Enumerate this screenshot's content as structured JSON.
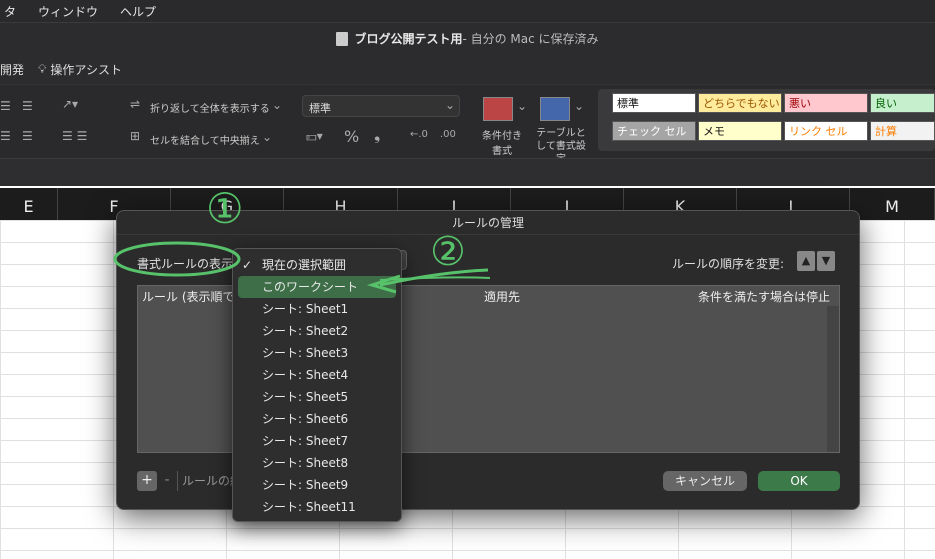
{
  "menubar": {
    "items": [
      "タ",
      "ウィンドウ",
      "ヘルプ"
    ]
  },
  "titlebar": {
    "doc_name": "ブログ公開テスト用",
    "suffix": " - 自分の Mac に保存済み"
  },
  "tabs": {
    "items": [
      "開発",
      "操作アシスト"
    ]
  },
  "ribbon": {
    "wrap_text": "折り返して全体を表示する",
    "merge_center": "セルを結合して中央揃え",
    "number_format": "標準",
    "percent": "%",
    "comma": "❟",
    "conditional_format": "条件付き\n書式",
    "table_format": "テーブルとして書式設定",
    "styles": [
      {
        "label": "標準",
        "bg": "#ffffff",
        "fg": "#111111"
      },
      {
        "label": "どちらでもない",
        "bg": "#ffeb9c",
        "fg": "#9c5700"
      },
      {
        "label": "悪い",
        "bg": "#ffc7ce",
        "fg": "#9c0006"
      },
      {
        "label": "良い",
        "bg": "#c6efce",
        "fg": "#006100"
      },
      {
        "label": "チェック セル",
        "bg": "#a5a5a5",
        "fg": "#ffffff"
      },
      {
        "label": "メモ",
        "bg": "#ffffcc",
        "fg": "#111111"
      },
      {
        "label": "リンク セル",
        "bg": "#ffffff",
        "fg": "#fa7d00"
      },
      {
        "label": "計算",
        "bg": "#f2f2f2",
        "fg": "#fa7d00"
      }
    ]
  },
  "columns": [
    "E",
    "F",
    "G",
    "H",
    "I",
    "J",
    "K",
    "L",
    "M"
  ],
  "dialog": {
    "title": "ルールの管理",
    "show_label": "書式ルールの表示:",
    "order_label": "ルールの順序を変更:",
    "list_headers": {
      "rule": "ルール (表示順で",
      "applies": "適用先",
      "stop": "条件を満たす場合は停止"
    },
    "add": "+",
    "remove": "-",
    "edit": "ルールの編",
    "cancel": "キャンセル",
    "ok": "OK"
  },
  "popup": {
    "items": [
      {
        "label": "現在の選択範囲",
        "checked": true
      },
      {
        "label": "このワークシート",
        "selected": true
      },
      {
        "label": "シート: Sheet1"
      },
      {
        "label": "シート: Sheet2"
      },
      {
        "label": "シート: Sheet3"
      },
      {
        "label": "シート: Sheet4"
      },
      {
        "label": "シート: Sheet5"
      },
      {
        "label": "シート: Sheet6"
      },
      {
        "label": "シート: Sheet7"
      },
      {
        "label": "シート: Sheet8"
      },
      {
        "label": "シート: Sheet9"
      },
      {
        "label": "シート: Sheet11"
      }
    ]
  },
  "annotations": {
    "one": "①",
    "two": "②"
  },
  "colors": {
    "accent_green": "#57c26a",
    "selection": "#3e6e47",
    "ok": "#3d7a4a"
  }
}
